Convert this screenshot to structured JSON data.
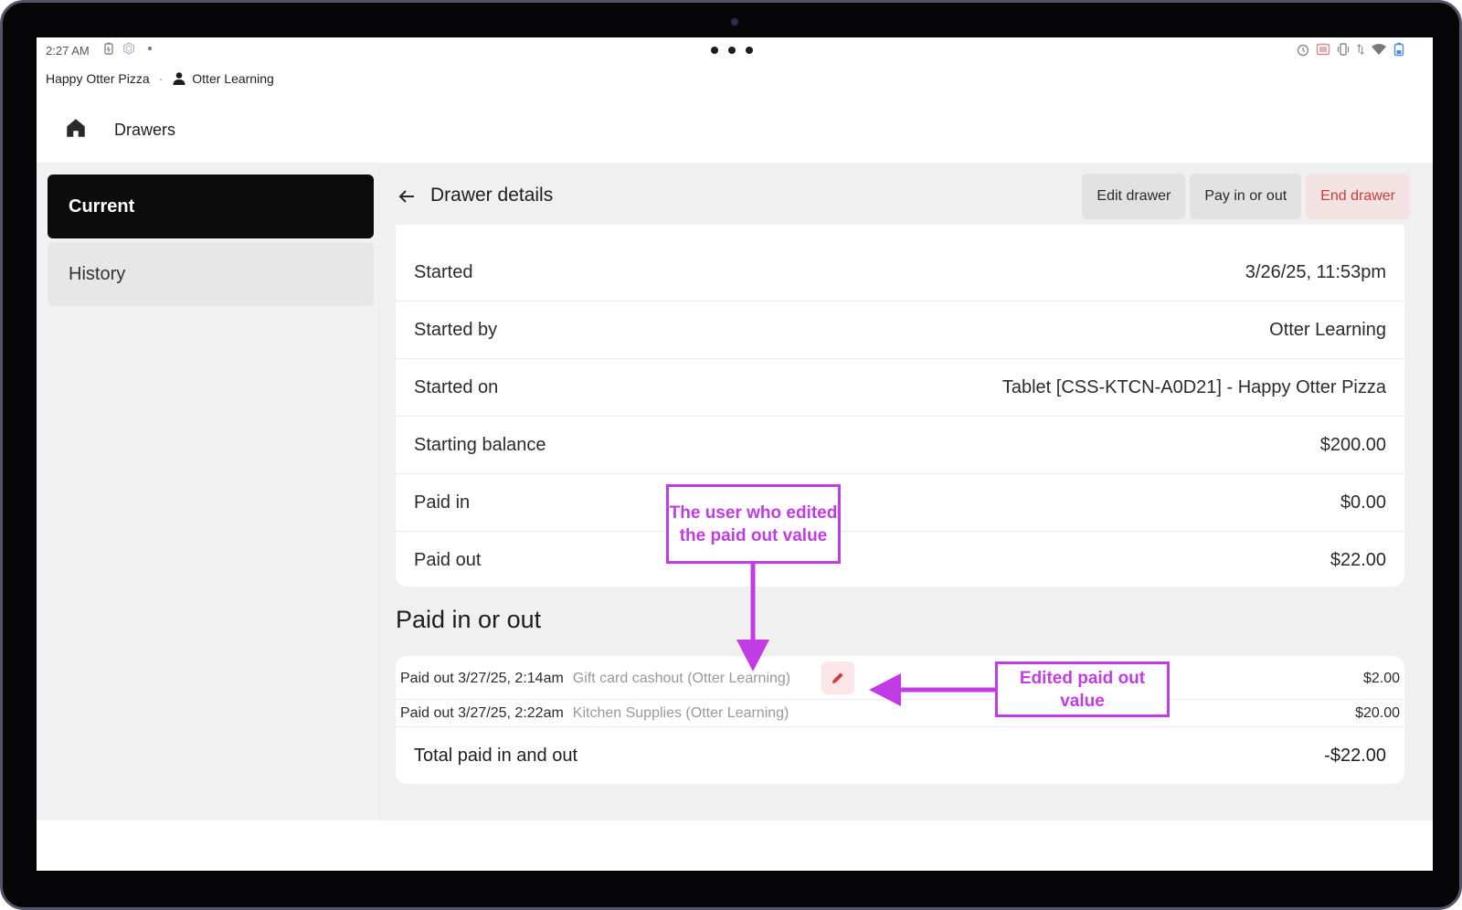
{
  "status_bar": {
    "time": "2:27 AM",
    "left_icons": [
      "battery-saver-icon",
      "app-hex-icon"
    ],
    "right_icons": [
      "alarm-icon",
      "cast-icon",
      "vibrate-icon",
      "data-arrows-icon",
      "wifi-icon",
      "battery-icon"
    ]
  },
  "account": {
    "business": "Happy Otter Pizza",
    "separator": "·",
    "user": "Otter Learning"
  },
  "app_bar": {
    "title": "Drawers"
  },
  "sidebar": {
    "items": [
      {
        "label": "Current",
        "active": true
      },
      {
        "label": "History",
        "active": false
      }
    ]
  },
  "detail_header": {
    "title": "Drawer details",
    "actions": {
      "edit": "Edit drawer",
      "pay": "Pay in or out",
      "end": "End drawer"
    }
  },
  "details": {
    "rows": [
      {
        "label": "Started",
        "value": "3/26/25, 11:53pm"
      },
      {
        "label": "Started by",
        "value": "Otter Learning"
      },
      {
        "label": "Started on",
        "value": "Tablet [CSS-KTCN-A0D21] - Happy Otter Pizza"
      },
      {
        "label": "Starting balance",
        "value": "$200.00"
      },
      {
        "label": "Paid in",
        "value": "$0.00"
      },
      {
        "label": "Paid out",
        "value": "$22.00"
      }
    ]
  },
  "paid_section": {
    "title": "Paid in or out",
    "transactions": [
      {
        "main": "Paid out 3/27/25, 2:14am",
        "note": "Gift card cashout (Otter Learning)",
        "amount": "$2.00",
        "edited": true
      },
      {
        "main": "Paid out 3/27/25, 2:22am",
        "note": "Kitchen Supplies (Otter Learning)",
        "amount": "$20.00",
        "edited": false
      }
    ],
    "total_label": "Total paid in and out",
    "total_value": "-$22.00"
  },
  "annotations": {
    "user_callout": "The user who edited the paid out value",
    "edited_callout": "Edited paid out value"
  },
  "colors": {
    "accent_annotation": "#c23ce6",
    "danger": "#d03b3b",
    "nav_active": "#0c0c0c"
  }
}
